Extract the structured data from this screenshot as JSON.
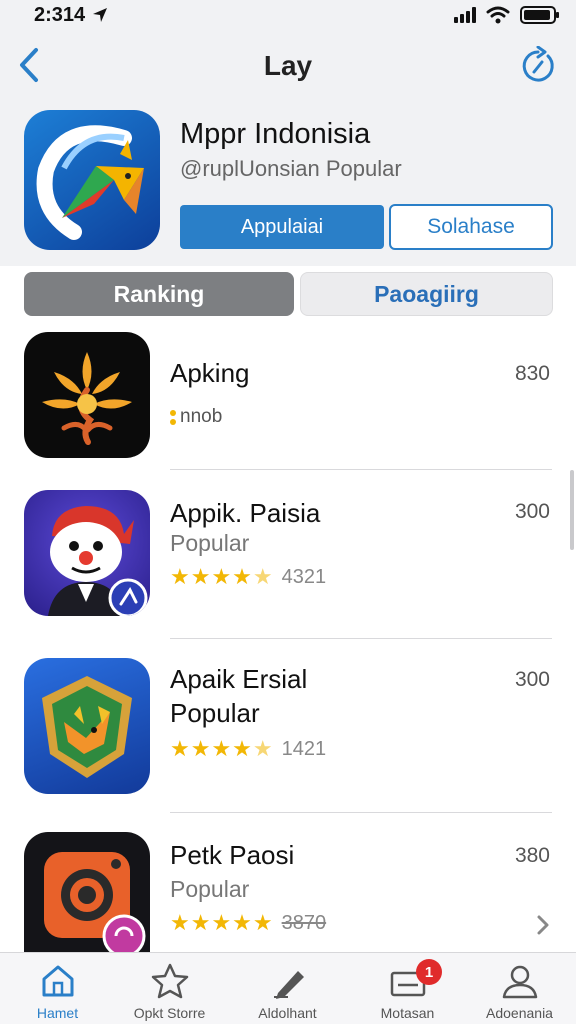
{
  "status_bar": {
    "time": "2:314"
  },
  "nav": {
    "title": "Lay"
  },
  "header": {
    "app_name": "Mppr Indonisia",
    "app_sub": "@ruplUonsian Popular",
    "primary_button": "Appulaiai",
    "secondary_button": "Solahase"
  },
  "segments": [
    {
      "label": "Ranking",
      "active": true
    },
    {
      "label": "Paoagiirg",
      "active": false
    }
  ],
  "apps": [
    {
      "name": "Apking",
      "sub": "nnob",
      "value": "830",
      "rating": null,
      "icon": "sun-leaf-icon"
    },
    {
      "name": "Appik. Paisia",
      "sub": "Popular",
      "value": "300",
      "rating": "4321",
      "stars": 4.5,
      "icon": "clown-mascot-icon"
    },
    {
      "name": "Apaik Ersial",
      "sub": "Popular",
      "value": "300",
      "rating": "1421",
      "stars": 4.5,
      "icon": "fox-shield-icon"
    },
    {
      "name": "Petk Paosi",
      "sub": "Popular",
      "value": "380",
      "rating": "3870",
      "stars": 5,
      "icon": "camera-icon"
    }
  ],
  "tabs": [
    {
      "label": "Hamet",
      "icon": "home-icon",
      "active": true
    },
    {
      "label": "Opkt Storre",
      "icon": "star-icon",
      "active": false
    },
    {
      "label": "Aldolhant",
      "icon": "pen-icon",
      "active": false
    },
    {
      "label": "Motasan",
      "icon": "inbox-icon",
      "active": false,
      "badge": "1"
    },
    {
      "label": "Adoenania",
      "icon": "person-icon",
      "active": false
    }
  ],
  "colors": {
    "accent": "#2a7fc8",
    "star": "#f2b705",
    "badge": "#e02b2b"
  }
}
